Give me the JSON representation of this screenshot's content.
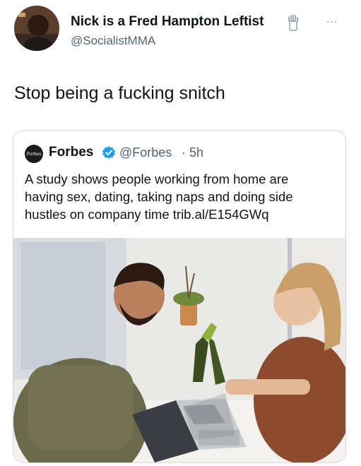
{
  "tweet": {
    "author": {
      "display_name": "Nick is a Fred Hampton Leftist",
      "handle": "@SocialistMMA",
      "emoji_icon": "raised-fist-emoji"
    },
    "text": "Stop being a fucking snitch",
    "more_icon": "···"
  },
  "quote": {
    "author": {
      "name": "Forbes",
      "avatar_text": "Forbes",
      "verified": true,
      "handle": "@Forbes",
      "separator": "·",
      "time": "5h"
    },
    "text_lines": [
      "A study shows people working from home are",
      "having sex, dating, taking naps and doing side",
      "hustles on company time trib.al/E154GWq"
    ]
  },
  "colors": {
    "text": "#0f1419",
    "secondary": "#536471",
    "border": "#cfd9de",
    "verified": "#1d9bf0"
  }
}
